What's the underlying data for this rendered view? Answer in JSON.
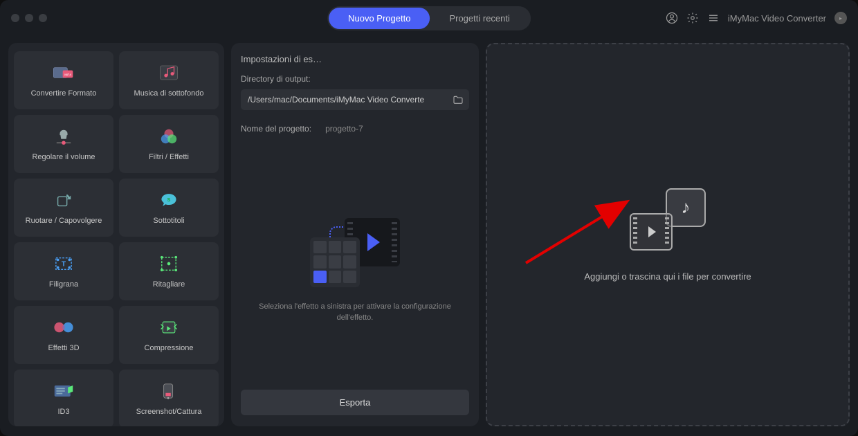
{
  "header": {
    "tab_new": "Nuovo Progetto",
    "tab_recent": "Progetti recenti",
    "app_name": "iMyMac Video Converter"
  },
  "tools": [
    {
      "label": "Convertire Formato",
      "icon": "convert"
    },
    {
      "label": "Musica di sottofondo",
      "icon": "music"
    },
    {
      "label": "Regolare il volume",
      "icon": "volume"
    },
    {
      "label": "Filtri / Effetti",
      "icon": "filters"
    },
    {
      "label": "Ruotare / Capovolgere",
      "icon": "rotate"
    },
    {
      "label": "Sottotitoli",
      "icon": "subtitles"
    },
    {
      "label": "Filigrana",
      "icon": "watermark"
    },
    {
      "label": "Ritagliare",
      "icon": "crop"
    },
    {
      "label": "Effetti 3D",
      "icon": "3d"
    },
    {
      "label": "Compressione",
      "icon": "compress"
    },
    {
      "label": "ID3",
      "icon": "id3"
    },
    {
      "label": "Screenshot/Cattura",
      "icon": "screenshot"
    }
  ],
  "center": {
    "title": "Impostazioni di es…",
    "output_dir_label": "Directory di output:",
    "output_dir_value": "/Users/mac/Documents/iMyMac Video Converte",
    "project_name_label": "Nome del progetto:",
    "project_name_value": "progetto-7",
    "hint_text": "Seleziona l'effetto a sinistra per attivare la configurazione dell'effetto.",
    "export_label": "Esporta"
  },
  "dropzone": {
    "text": "Aggiungi o trascina qui i file per convertire"
  }
}
